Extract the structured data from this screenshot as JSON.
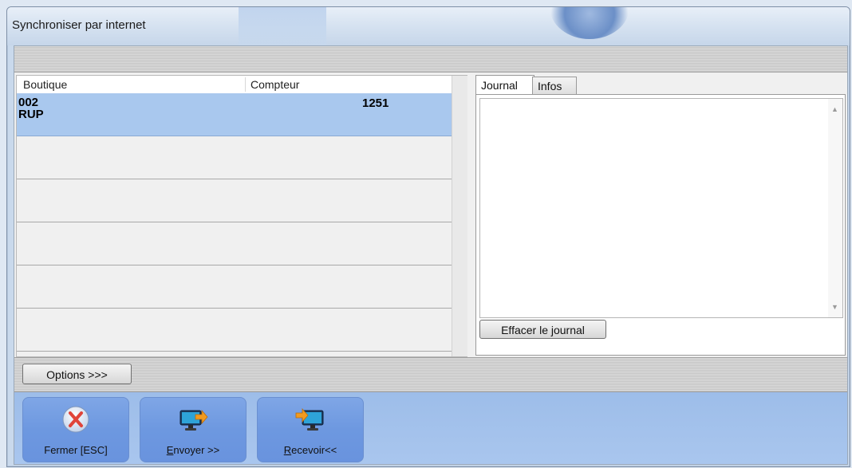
{
  "window": {
    "title": "Synchroniser par internet"
  },
  "grid": {
    "columns": [
      "Boutique",
      "Compteur"
    ],
    "rows": [
      {
        "boutique_line1": "002",
        "boutique_line2": "RUP",
        "compteur": "1251",
        "selected": true
      },
      {
        "boutique_line1": "",
        "boutique_line2": "",
        "compteur": ""
      },
      {
        "boutique_line1": "",
        "boutique_line2": "",
        "compteur": ""
      },
      {
        "boutique_line1": "",
        "boutique_line2": "",
        "compteur": ""
      },
      {
        "boutique_line1": "",
        "boutique_line2": "",
        "compteur": ""
      },
      {
        "boutique_line1": "",
        "boutique_line2": "",
        "compteur": ""
      }
    ]
  },
  "tabs": {
    "journal": "Journal",
    "infos": "Infos",
    "active": "journal"
  },
  "journal": {
    "clear_label": "Effacer le journal"
  },
  "options": {
    "label": "Options >>>"
  },
  "toolbar": {
    "close": {
      "label_u": "",
      "label_rest": "Fermer [ESC]",
      "icon": "close-icon"
    },
    "send": {
      "label_u": "E",
      "label_rest": "nvoyer >>",
      "icon": "send-monitor-icon"
    },
    "receive": {
      "label_u": "R",
      "label_rest": "ecevoir<<",
      "icon": "receive-monitor-icon"
    }
  },
  "colors": {
    "selection": "#a9c8ee",
    "toolbar_button": "#6d98e0",
    "close_x": "#e0443a",
    "arrow_orange": "#f29a1f"
  }
}
